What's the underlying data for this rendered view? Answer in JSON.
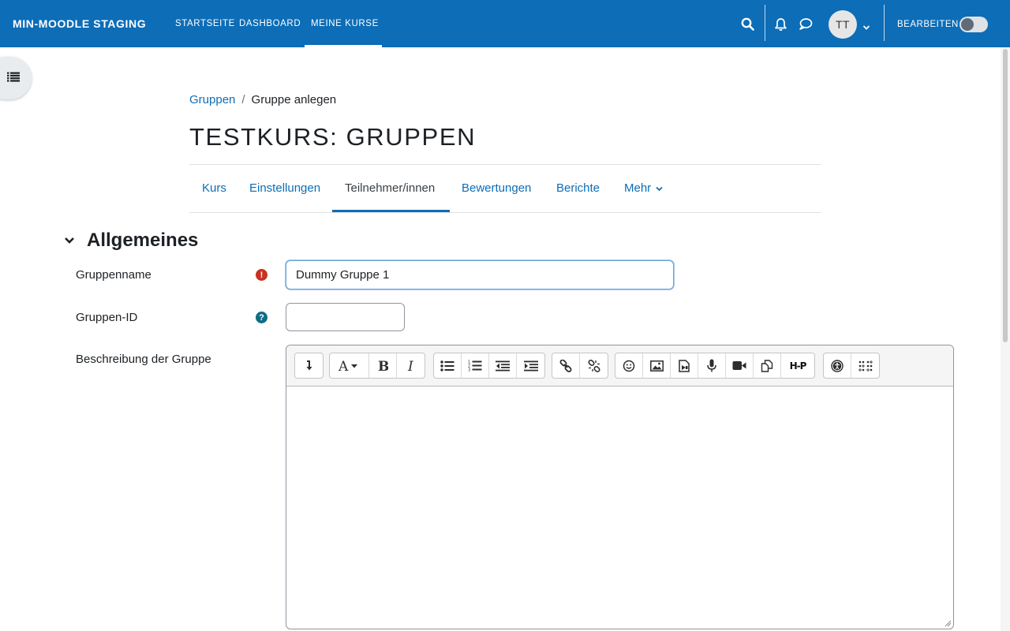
{
  "navbar": {
    "brand": "MIN-MOODLE STAGING",
    "links": [
      "STARTSEITE",
      "DASHBOARD",
      "MEINE KURSE"
    ],
    "active_link": "MEINE KURSE",
    "avatar_initials": "TT",
    "edit_mode_label": "BEARBEITEN",
    "edit_mode_on": false,
    "icons": [
      "search-icon",
      "bell-icon",
      "chat-icon",
      "chevron-down-icon"
    ]
  },
  "breadcrumb": {
    "items": [
      "Gruppen",
      "Gruppe anlegen"
    ]
  },
  "page": {
    "title": "TESTKURS: GRUPPEN"
  },
  "secondary_nav": {
    "tabs": [
      "Kurs",
      "Einstellungen",
      "Teilnehmer/innen",
      "Bewertungen",
      "Berichte",
      "Mehr"
    ],
    "active_tab": "Teilnehmer/innen"
  },
  "section": {
    "title": "Allgemeines",
    "expanded": true
  },
  "form": {
    "group_name": {
      "label": "Gruppenname",
      "value": "Dummy Gruppe 1",
      "required": true
    },
    "group_id": {
      "label": "Gruppen-ID",
      "value": ""
    },
    "description": {
      "label": "Beschreibung der Gruppe",
      "value": ""
    }
  },
  "editor_toolbar": {
    "groups": [
      [
        "collapse-icon"
      ],
      [
        "font-style-icon",
        "bold-icon",
        "italic-icon"
      ],
      [
        "bullet-list-icon",
        "numbered-list-icon",
        "outdent-icon",
        "indent-icon"
      ],
      [
        "link-icon",
        "unlink-icon"
      ],
      [
        "emoji-icon",
        "image-icon",
        "media-file-icon",
        "record-audio-icon",
        "record-video-icon",
        "manage-files-icon",
        "h5p-icon"
      ],
      [
        "accessibility-checker-icon",
        "screenreader-helper-icon"
      ]
    ],
    "h5p_label": "H-P"
  },
  "colors": {
    "brand": "#0d6db7",
    "required": "#ca3120",
    "help": "#0f6e84"
  }
}
